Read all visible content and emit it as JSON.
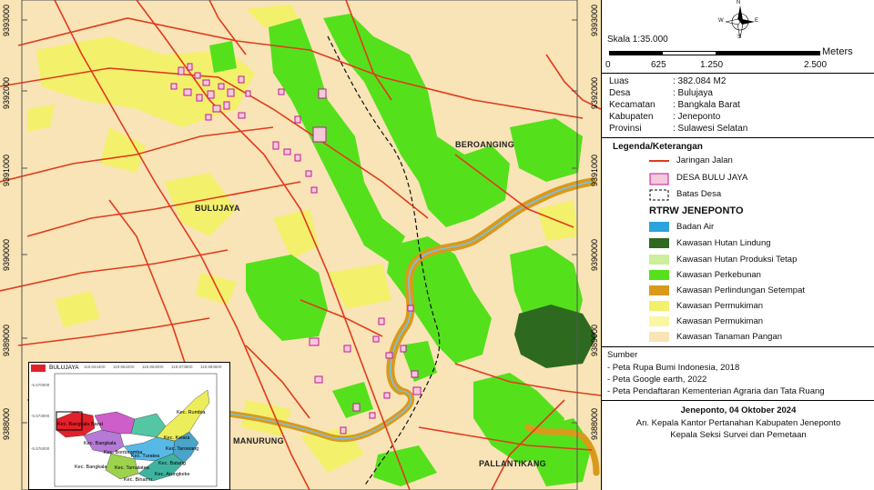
{
  "map": {
    "y_labels": [
      "9393000",
      "9392000",
      "9391000",
      "9390000",
      "9389000",
      "9388000"
    ],
    "places": {
      "bulujaya": "BULUJAYA",
      "beroanging": "BEROANGING",
      "pallantikang": "PALLANTIKANG",
      "manurung": "MANURUNG"
    }
  },
  "inset": {
    "legend_label": "BULUJAYA",
    "x_ticks": [
      "119.844400",
      "119.854200",
      "119.864000",
      "119.873800",
      "119.883600"
    ],
    "y_ticks": [
      "-5.570000",
      "-5.573000",
      "-5.576000"
    ],
    "districts": [
      "Kec. Rumbia",
      "Kec. Bangkala Barat",
      "Kec. Kelara",
      "Kec. Bangkala",
      "Kec. Bontoramba",
      "Kec. Tarowang",
      "Kec. Turatea",
      "Kec. Batang",
      "Kec. Tamalatea",
      "Kec. Bangkala",
      "Kec. Binamu",
      "Kec. Arungkeke"
    ],
    "colors": {
      "region": "#0d0d0d",
      "highlight": "#e4202a"
    }
  },
  "panel": {
    "compass": {
      "n": "N",
      "s": "S",
      "e": "E",
      "w": "W"
    },
    "scale_text": "Skala 1:35.000",
    "scale_unit": "Meters",
    "scale_ticks": [
      "0",
      "625",
      "1.250",
      "2.500"
    ],
    "info": [
      {
        "k": "Luas",
        "v": ": 382.084 M2"
      },
      {
        "k": "Desa",
        "v": ": Bulujaya"
      },
      {
        "k": "Kecamatan",
        "v": ": Bangkala Barat"
      },
      {
        "k": "Kabupaten",
        "v": ": Jeneponto"
      },
      {
        "k": "Provinsi",
        "v": ": Sulawesi Selatan"
      }
    ],
    "legend_title": "Legenda/Keterangan",
    "legend_basic": [
      {
        "label": "Jaringan Jalan",
        "icon": "road-line"
      },
      {
        "label": "DESA BULU JAYA",
        "icon": "village-polygon"
      },
      {
        "label": "Batas Desa",
        "icon": "dashed-boundary"
      }
    ],
    "rtrw_title": "RTRW JENEPONTO",
    "legend_rtrw": [
      {
        "label": "Badan Air",
        "color": "#2aa4dc"
      },
      {
        "label": "Kawasan Hutan Lindung",
        "color": "#2d6a1f"
      },
      {
        "label": "Kawasan Hutan Produksi Tetap",
        "color": "#cdee9a"
      },
      {
        "label": "Kawasan Perkebunan",
        "color": "#55e01c"
      },
      {
        "label": "Kawasan Perlindungan Setempat",
        "color": "#d99a1c"
      },
      {
        "label": "Kawasan Permukiman",
        "color": "#f3f06c"
      },
      {
        "label": "Kawasan Permukiman",
        "color": "#fbf7a0"
      },
      {
        "label": "Kawasan Tanaman Pangan",
        "color": "#f8e4b6"
      }
    ],
    "sources_title": "Sumber",
    "sources": [
      "- Peta Rupa Bumi Indonesia, 2018",
      "- Peta Google earth, 2022",
      "- Peta Pendaftaran Kementerian Agraria dan Tata Ruang"
    ],
    "sign": {
      "place_date": "Jeneponto, 04 Oktober 2024",
      "line1": "An. Kepala Kantor Pertanahan Kabupaten Jeneponto",
      "line2": "Kepala Seksi Survei dan Pemetaan"
    }
  }
}
